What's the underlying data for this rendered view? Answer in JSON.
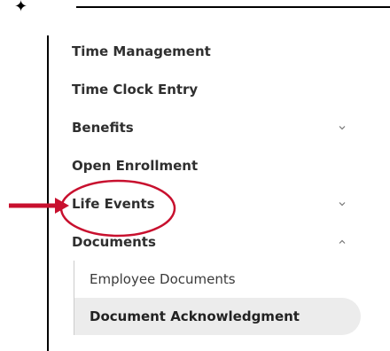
{
  "nav": {
    "items": [
      {
        "label": "Time Management",
        "chevron": ""
      },
      {
        "label": "Time Clock Entry",
        "chevron": ""
      },
      {
        "label": "Benefits",
        "chevron": "chevron-down-icon"
      },
      {
        "label": "Open Enrollment",
        "chevron": ""
      },
      {
        "label": "Life Events",
        "chevron": "chevron-down-icon"
      },
      {
        "label": "Documents",
        "chevron": "chevron-up-icon"
      }
    ],
    "sub_items": [
      {
        "label": "Employee Documents",
        "active": false
      },
      {
        "label": "Document Acknowledgment",
        "active": true
      }
    ]
  },
  "annotation": {
    "arrow_color": "#c8102e",
    "circle_color": "#c8102e"
  }
}
